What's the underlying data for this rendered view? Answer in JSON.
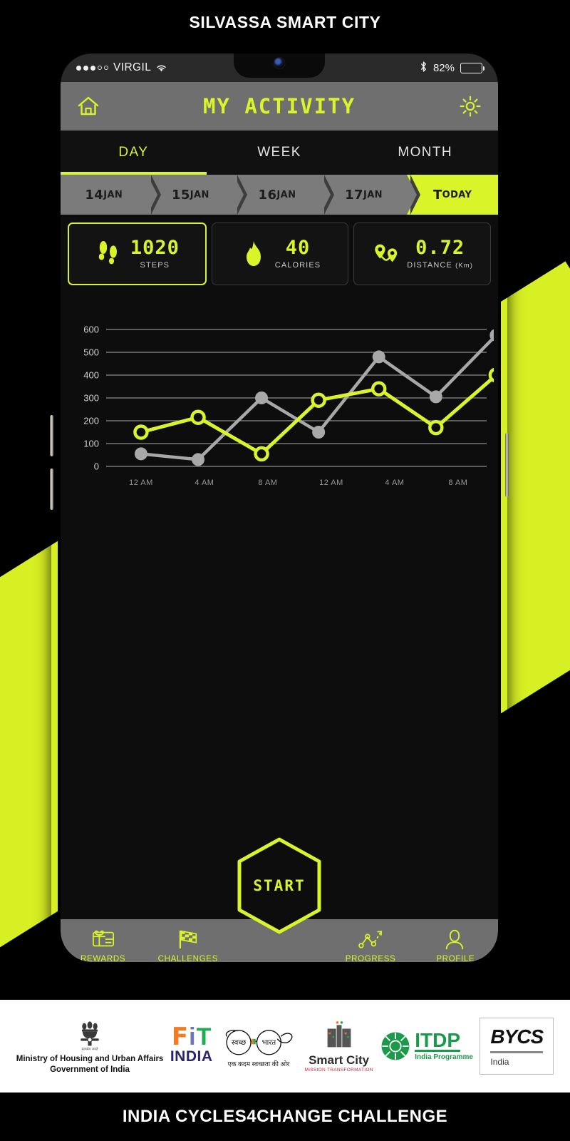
{
  "top_banner": {
    "title": "SILVASSA SMART CITY"
  },
  "bottom_banner": {
    "title": "INDIA CYCLES4CHANGE CHALLENGE"
  },
  "status_bar": {
    "carrier": "VIRGIL",
    "battery_percent": "82%",
    "battery_level": 82,
    "signal_filled": 3,
    "signal_total": 5,
    "icons": [
      "signal-dots-icon",
      "wifi-icon",
      "bluetooth-icon",
      "battery-icon"
    ]
  },
  "app_header": {
    "title": "MY ACTIVITY",
    "home_icon": "home-icon",
    "settings_icon": "gear-icon",
    "accent": "#d9f52a"
  },
  "tabs": [
    {
      "label": "DAY",
      "active": true
    },
    {
      "label": "WEEK",
      "active": false
    },
    {
      "label": "MONTH",
      "active": false
    }
  ],
  "date_strip": [
    {
      "num": "14",
      "mon": "Jan",
      "label": "14Jan",
      "active": false
    },
    {
      "num": "15",
      "mon": "Jan",
      "label": "15Jan",
      "active": false
    },
    {
      "num": "16",
      "mon": "Jan",
      "label": "16Jan",
      "active": false
    },
    {
      "num": "17",
      "mon": "Jan",
      "label": "17Jan",
      "active": false
    },
    {
      "num": "T",
      "mon": "oday",
      "label": "Today",
      "active": true
    }
  ],
  "stats": [
    {
      "value": "1020",
      "label": "STEPS",
      "unit": "",
      "icon": "footsteps-icon",
      "active": true
    },
    {
      "value": "40",
      "label": "CALORIES",
      "unit": "",
      "icon": "flame-icon",
      "active": false
    },
    {
      "value": "0.72",
      "label": "DISTANCE",
      "unit": "(Km)",
      "icon": "map-pins-icon",
      "active": false
    }
  ],
  "chart_data": {
    "type": "line",
    "title": "",
    "xlabel": "",
    "ylabel": "",
    "ylim": [
      0,
      600
    ],
    "yticks": [
      0,
      100,
      200,
      300,
      400,
      500,
      600
    ],
    "xticks": [
      "12 AM",
      "4 AM",
      "8 AM",
      "12 AM",
      "4 AM",
      "8 AM"
    ],
    "grid": true,
    "legend": "none",
    "x": [
      0.55,
      1.45,
      2.45,
      3.35,
      4.3,
      5.2,
      6.15
    ],
    "series": [
      {
        "name": "steps-gray",
        "color": "#a8a8a8",
        "values": [
          55,
          30,
          300,
          150,
          480,
          305,
          575
        ]
      },
      {
        "name": "steps-yellow",
        "color": "#d9f52a",
        "values": [
          150,
          215,
          55,
          290,
          340,
          170,
          400
        ]
      }
    ]
  },
  "start_button": {
    "label": "START"
  },
  "bottom_nav": [
    {
      "label": "REWARDS",
      "icon": "gift-card-icon"
    },
    {
      "label": "CHALLENGES",
      "icon": "checkered-flag-icon"
    },
    {
      "label": "PROGRESS",
      "icon": "progress-chart-icon"
    },
    {
      "label": "PROFILE",
      "icon": "person-icon"
    }
  ],
  "footer_logos": [
    {
      "id": "ministry-logo",
      "line1": "Ministry of Housing and Urban Affairs",
      "line2": "Government of India",
      "sub": "सत्यमेव जयते"
    },
    {
      "id": "fit-india-logo",
      "f": "F",
      "i": "i",
      "t": "T",
      "india": "INDIA"
    },
    {
      "id": "swachh-bharat-logo",
      "hi1": "स्वच्छ",
      "hi2": "भारत",
      "hi3": "एक कदम स्वच्छता की ओर"
    },
    {
      "id": "smart-city-logo",
      "name": "Smart City",
      "sub": "MISSION TRANSFORMATION"
    },
    {
      "id": "itdp-logo",
      "main": "ITDP",
      "sub": "India Programme"
    },
    {
      "id": "bycs-logo",
      "main": "BYCS",
      "sub": "India"
    }
  ]
}
